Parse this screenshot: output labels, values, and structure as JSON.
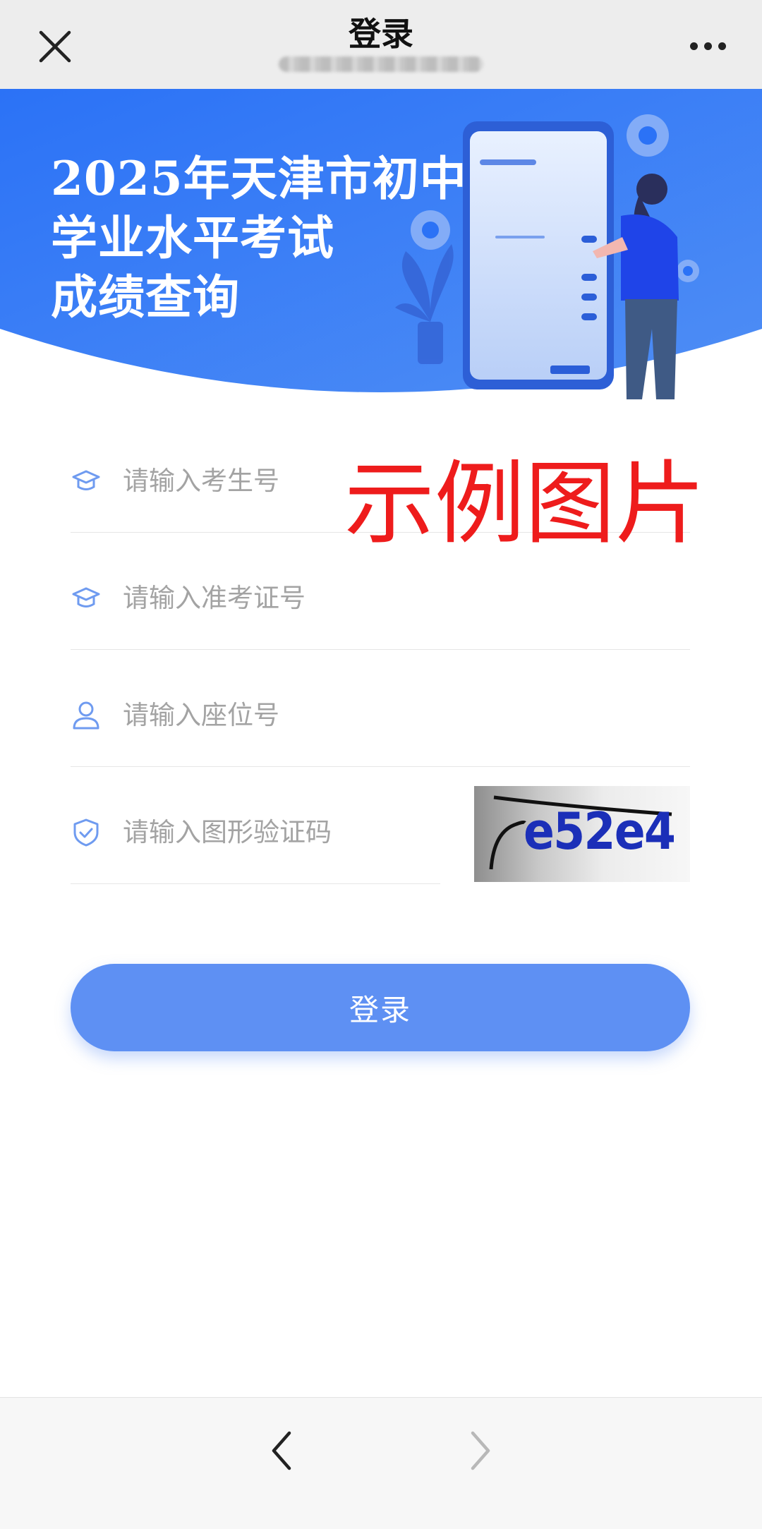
{
  "topbar": {
    "title": "登录",
    "close_icon": "close-icon",
    "more_icon": "more-icon"
  },
  "banner": {
    "lines": [
      "2025年天津市初中",
      "学业水平考试",
      "成绩查询"
    ],
    "illustration": "phone-login-illustration",
    "colors": {
      "gradient_start": "#2f78f7",
      "gradient_end": "#4a8df6"
    }
  },
  "form": {
    "exam_number": {
      "placeholder": "请输入考生号",
      "value": "",
      "icon": "graduation-cap-icon"
    },
    "admission_ticket": {
      "placeholder": "请输入准考证号",
      "value": "",
      "icon": "graduation-cap-icon"
    },
    "seat_number": {
      "placeholder": "请输入座位号",
      "value": "",
      "icon": "user-icon"
    },
    "captcha": {
      "placeholder": "请输入图形验证码",
      "value": "",
      "icon": "shield-check-icon",
      "image_text": "e52e4"
    }
  },
  "login_button": {
    "label": "登录",
    "color": "#5e90f3"
  },
  "watermark": {
    "text": "示例图片",
    "color": "#ee1c1c"
  },
  "bottom_nav": {
    "back_icon": "chevron-left-icon",
    "forward_icon": "chevron-right-icon"
  }
}
